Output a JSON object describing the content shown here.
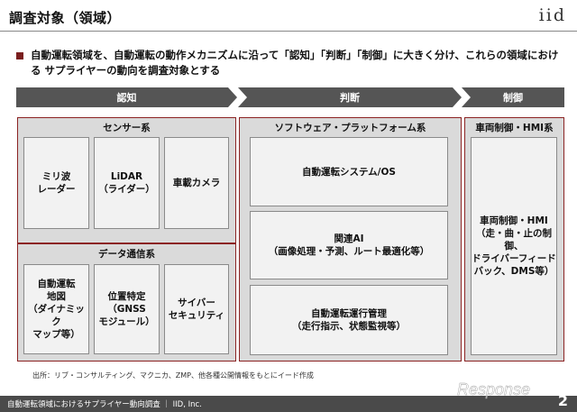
{
  "slide": {
    "title": "調査対象（領域）",
    "logo": "iid",
    "page_number": "2"
  },
  "intro_text": "自動運転領域を、自動運転の動作メカニズムに沿って「認知」「判断」「制御」に大きく分け、これらの領域における サプライヤーの動向を調査対象とする",
  "phases": {
    "cognition": "認知",
    "judgment": "判断",
    "control": "制御"
  },
  "groups": {
    "sensor": {
      "title": "センサー系",
      "items": [
        "ミリ波\nレーダー",
        "LiDAR\n（ライダー）",
        "車載カメラ"
      ]
    },
    "data_comm": {
      "title": "データ通信系",
      "items": [
        "自動運転\n地図\n（ダイナミック\nマップ等）",
        "位置特定\n（GNSS\nモジュール）",
        "サイバー\nセキュリティ"
      ]
    },
    "software": {
      "title": "ソフトウェア・プラットフォーム系",
      "items": [
        "自動運転システム/OS",
        "関連AI\n（画像処理・予測、ルート最適化等）",
        "自動運転運行管理\n（走行指示、状態監視等）"
      ]
    },
    "vehicle": {
      "title": "車両制御・HMI系",
      "items": [
        "車両制御・HMI\n（走・曲・止の制御、\nドライバーフィード\nバック、DMS等）"
      ]
    }
  },
  "source_note": "出所：リブ・コンサルティング、マクニカ、ZMP、他各種公開情報をもとにイード作成",
  "footer": {
    "text": "自動運転領域におけるサプライヤー動向調査 ｜ IID, Inc.",
    "watermark": "Response"
  }
}
